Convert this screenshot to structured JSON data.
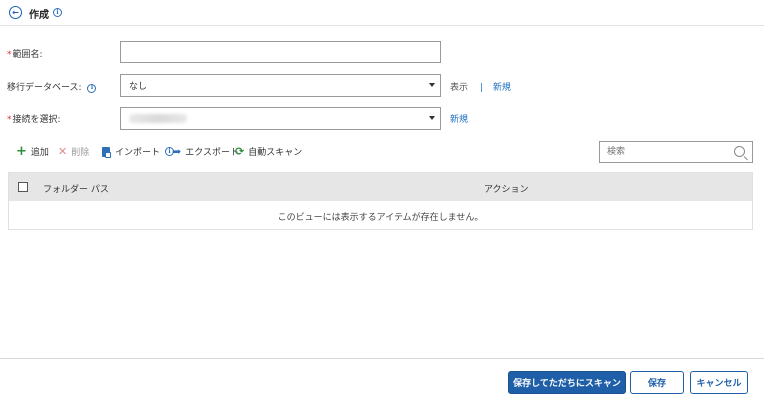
{
  "header": {
    "title": "作成"
  },
  "form": {
    "range_name": {
      "label": "範囲名:",
      "value": "",
      "required": true
    },
    "migration_db": {
      "label": "移行データベース:",
      "selected": "なし",
      "show_label": "表示",
      "separator": "|",
      "new_label": "新規"
    },
    "connection": {
      "label": "接続を選択:",
      "selected": "",
      "required": true,
      "new_label": "新規"
    }
  },
  "toolbar": {
    "add": "追加",
    "delete": "削除",
    "import": "インポート",
    "export": "エクスポート",
    "auto_scan": "自動スキャン",
    "search_placeholder": "検索"
  },
  "table": {
    "columns": [
      "フォルダー パス",
      "アクション"
    ],
    "rows": [],
    "empty_message": "このビューには表示するアイテムが存在しません。"
  },
  "footer": {
    "save_and_scan": "保存してただちにスキャン",
    "save": "保存",
    "cancel": "キャンセル"
  },
  "colors": {
    "primary": "#1f5fa8",
    "link": "#1f6fc2",
    "required": "#d32f2f",
    "add_green": "#2e8b3a"
  },
  "icons": {
    "back": "arrow-left-circle-icon",
    "info": "info-icon",
    "add": "plus-icon",
    "delete": "x-icon",
    "import": "import-icon",
    "export": "share-arrow-icon",
    "scan": "refresh-icon",
    "search": "search-icon",
    "dropdown": "caret-down-icon"
  }
}
